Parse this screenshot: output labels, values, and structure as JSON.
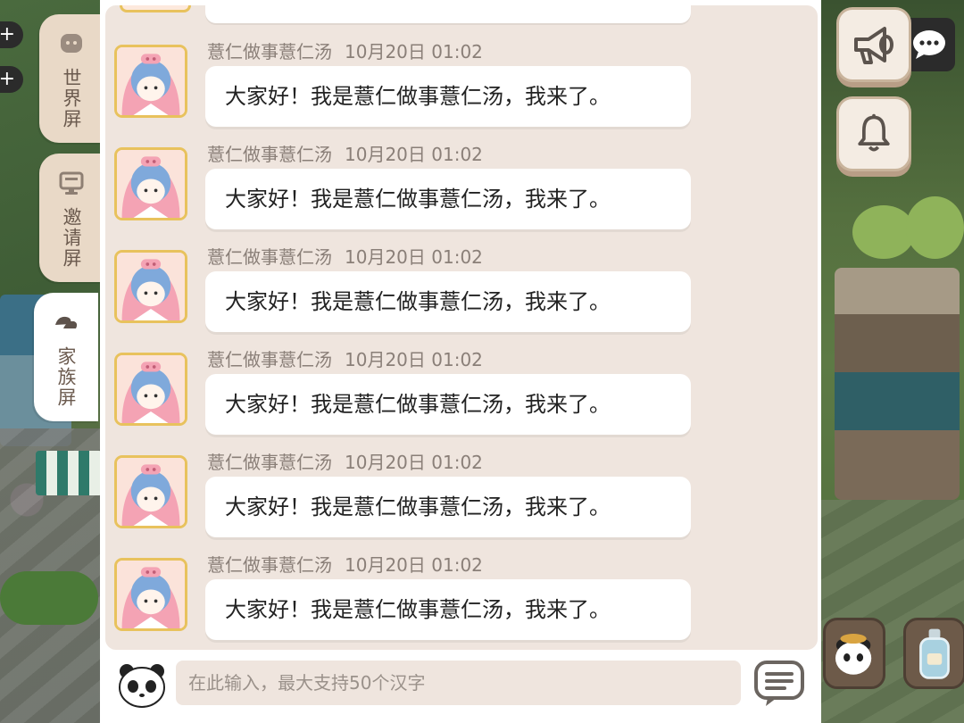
{
  "side_tabs": [
    {
      "label": "世界屏",
      "icon": "world-chat-icon",
      "active": false
    },
    {
      "label": "邀请屏",
      "icon": "monitor-icon",
      "active": false
    },
    {
      "label": "家族屏",
      "icon": "family-icon",
      "active": true
    }
  ],
  "messages": [
    {
      "sender": "薏仁做事薏仁汤",
      "time": "10月20日 01:02",
      "text": "大家好！我是薏仁做事薏仁汤，我来了。"
    },
    {
      "sender": "薏仁做事薏仁汤",
      "time": "10月20日 01:02",
      "text": "大家好！我是薏仁做事薏仁汤，我来了。"
    },
    {
      "sender": "薏仁做事薏仁汤",
      "time": "10月20日 01:02",
      "text": "大家好！我是薏仁做事薏仁汤，我来了。"
    },
    {
      "sender": "薏仁做事薏仁汤",
      "time": "10月20日 01:02",
      "text": "大家好！我是薏仁做事薏仁汤，我来了。"
    },
    {
      "sender": "薏仁做事薏仁汤",
      "time": "10月20日 01:02",
      "text": "大家好！我是薏仁做事薏仁汤，我来了。"
    },
    {
      "sender": "薏仁做事薏仁汤",
      "time": "10月20日 01:02",
      "text": "大家好！我是薏仁做事薏仁汤，我来了。"
    }
  ],
  "input": {
    "placeholder": "在此输入，最大支持50个汉字",
    "value": ""
  },
  "icons": {
    "emoji": "panda-icon",
    "quick_phrases": "menu-lines-icon",
    "announcement": "megaphone-icon",
    "notification": "bell-icon",
    "more": "chat-more-icon"
  },
  "colors": {
    "panel_bg": "#efe5de",
    "bubble_bg": "#ffffff",
    "avatar_border": "#e8c25d",
    "tab_bg": "#e9d9c7",
    "text_meta": "#8a7f78"
  }
}
